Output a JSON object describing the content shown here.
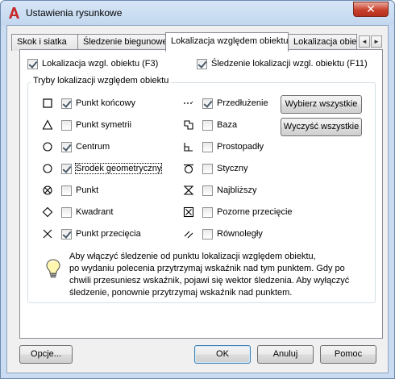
{
  "window": {
    "title": "Ustawienia rysunkowe",
    "close_glyph": "✕"
  },
  "tabs": [
    {
      "label": "Skok i siatka",
      "active": false
    },
    {
      "label": "Śledzenie biegunowe",
      "active": false
    },
    {
      "label": "Lokalizacja względem obiektu",
      "active": true
    },
    {
      "label": "Lokalizacja obiek",
      "active": false
    }
  ],
  "tab_scroll": {
    "left": "◄",
    "right": "►"
  },
  "top_options": {
    "osnap_on": {
      "label": "Lokalizacja wzgl. obiektu (F3)",
      "checked": true
    },
    "otrack_on": {
      "label": "Śledzenie lokalizacji wzgl. obiektu (F11)",
      "checked": true
    }
  },
  "modes_group": {
    "title": "Tryby lokalizacji względem obiektu",
    "left": [
      {
        "label": "Punkt końcowy",
        "checked": true,
        "icon": "square-marker-icon"
      },
      {
        "label": "Punkt symetrii",
        "checked": false,
        "icon": "triangle-marker-icon"
      },
      {
        "label": "Centrum",
        "checked": true,
        "icon": "circle-marker-icon"
      },
      {
        "label": "Środek geometryczny",
        "checked": true,
        "icon": "circle-marker-icon"
      },
      {
        "label": "Punkt",
        "checked": false,
        "icon": "node-marker-icon"
      },
      {
        "label": "Kwadrant",
        "checked": false,
        "icon": "diamond-marker-icon"
      },
      {
        "label": "Punkt przecięcia",
        "checked": true,
        "icon": "x-marker-icon"
      }
    ],
    "right": [
      {
        "label": "Przedłużenie",
        "checked": true,
        "icon": "extension-marker-icon"
      },
      {
        "label": "Baza",
        "checked": false,
        "icon": "insertion-marker-icon"
      },
      {
        "label": "Prostopadły",
        "checked": false,
        "icon": "perpendicular-marker-icon"
      },
      {
        "label": "Styczny",
        "checked": false,
        "icon": "tangent-marker-icon"
      },
      {
        "label": "Najbliższy",
        "checked": false,
        "icon": "nearest-marker-icon"
      },
      {
        "label": "Pozorne przecięcie",
        "checked": false,
        "icon": "apparent-intersection-marker-icon"
      },
      {
        "label": "Równoległy",
        "checked": false,
        "icon": "parallel-marker-icon"
      }
    ],
    "select_all_label": "Wybierz wszystkie",
    "clear_all_label": "Wyczyść wszystkie"
  },
  "info": {
    "icon": "lightbulb-icon",
    "lines": [
      "Aby włączyć śledzenie od punktu lokalizacji względem obiektu,",
      "po wydaniu polecenia przytrzymaj wskaźnik nad tym punktem. Gdy po",
      "chwili przesuniesz wskaźnik, pojawi się wektor śledzenia. Aby wyłączyć",
      "śledzenie, ponownie przytrzymaj wskaźnik nad punktem."
    ]
  },
  "footer": {
    "options_label": "Opcje...",
    "ok_label": "OK",
    "cancel_label": "Anuluj",
    "help_label": "Pomoc"
  }
}
